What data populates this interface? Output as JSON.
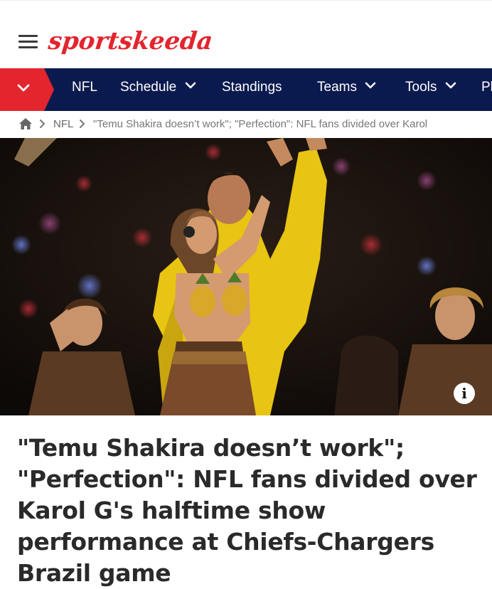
{
  "header": {
    "logo_text": "sportskeeda",
    "menu_icon": "hamburger-menu-icon",
    "brand_color": "#e3252e"
  },
  "nav": {
    "background": "#0b1a4e",
    "toggle_icon": "chevron-down-icon",
    "items": [
      {
        "label": "NFL",
        "has_dropdown": false
      },
      {
        "label": "Schedule",
        "has_dropdown": true
      },
      {
        "label": "Standings",
        "has_dropdown": false
      },
      {
        "label": "Teams",
        "has_dropdown": true
      },
      {
        "label": "Tools",
        "has_dropdown": true
      },
      {
        "label": "Pl",
        "has_dropdown": false
      }
    ]
  },
  "breadcrumb": {
    "home_icon": "home-icon",
    "section": "NFL",
    "current": "\"Temu Shakira doesn’t work\"; \"Perfection\": NFL fans divided over Karol"
  },
  "hero": {
    "info_icon": "info-icon",
    "info_label": "i"
  },
  "article": {
    "title": "\"Temu Shakira doesn’t work\"; \"Perfection\": NFL fans divided over Karol G's halftime show performance at Chiefs-Chargers Brazil game"
  }
}
